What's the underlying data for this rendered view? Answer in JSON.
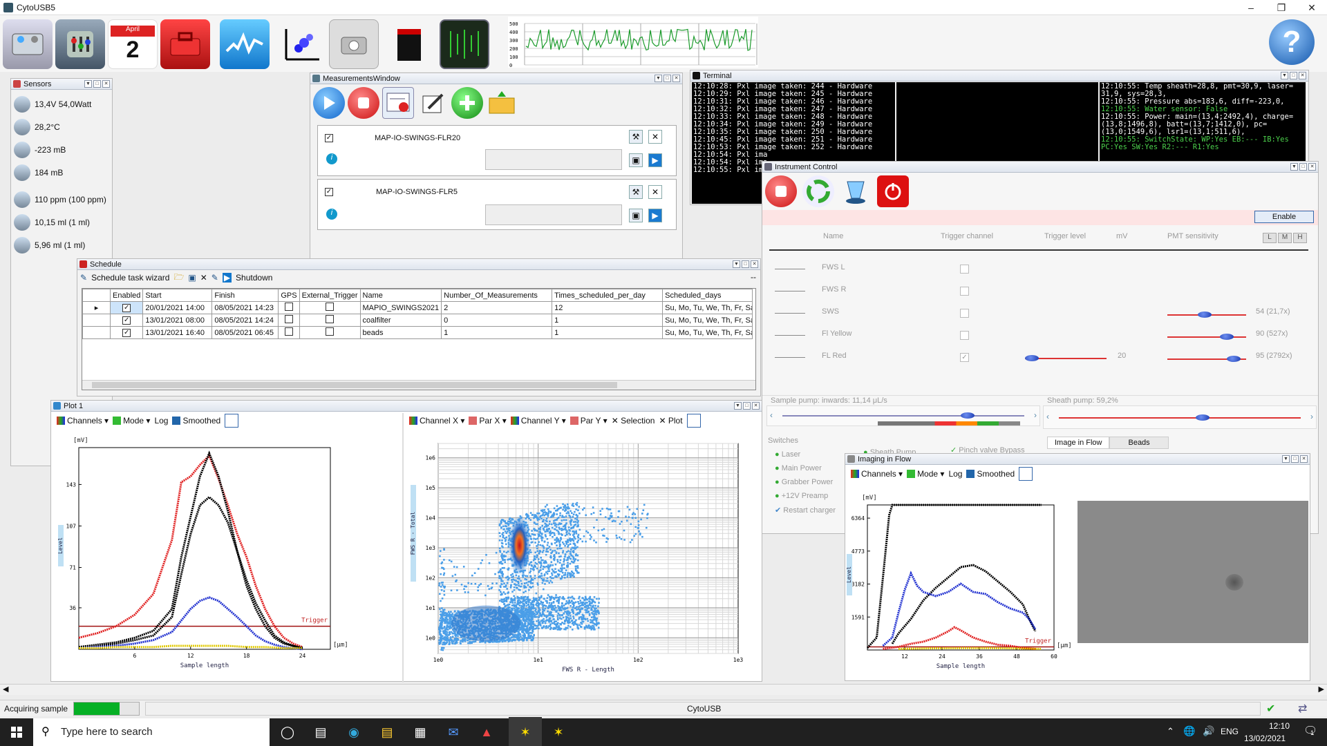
{
  "app": {
    "title": "CytoUSB5"
  },
  "toolbar": {
    "icons": [
      "instrument-icon",
      "sensors-panel-icon",
      "schedule-calendar-icon",
      "toolbox-icon",
      "signal-wave-icon",
      "scatter-plot-icon",
      "camera-icon",
      "cube-icon",
      "terminal-matrix-icon"
    ],
    "calendar_month": "April",
    "calendar_day": "2",
    "mini_chart": {
      "yticks": [
        "500",
        "400",
        "300",
        "200",
        "100",
        "0"
      ]
    },
    "help_symbol": "?"
  },
  "sensors": {
    "title": "Sensors",
    "items": [
      {
        "icon": "battery-icon",
        "value": "13,4V 54,0Watt"
      },
      {
        "icon": "thermometer-icon",
        "value": "28,2°C"
      },
      {
        "icon": "pressure-gauge-icon",
        "value": "-223 mB"
      },
      {
        "icon": "gauge-icon",
        "value": "184 mB"
      },
      {
        "icon": "flask-icon",
        "value": "110 ppm (100 ppm)"
      },
      {
        "icon": "sheath-flask-icon",
        "value": "10,15 ml (1 ml)"
      },
      {
        "icon": "syringe-icon",
        "value": "5,96 ml (1 ml)"
      }
    ]
  },
  "measurements": {
    "title": "MeasurementsWindow",
    "items": [
      {
        "name": "MAP-IO-SWINGS-FLR20"
      },
      {
        "name": "MAP-IO-SWINGS-FLR5"
      }
    ]
  },
  "terminal": {
    "title": "Terminal",
    "left_lines": [
      "12:10:28: Pxl image taken: 244 - Hardware",
      "12:10:29: Pxl image taken: 245 - Hardware",
      "12:10:31: Pxl image taken: 246 - Hardware",
      "12:10:32: Pxl image taken: 247 - Hardware",
      "12:10:33: Pxl image taken: 248 - Hardware",
      "12:10:34: Pxl image taken: 249 - Hardware",
      "12:10:35: Pxl image taken: 250 - Hardware",
      "12:10:45: Pxl image taken: 251 - Hardware",
      "12:10:53: Pxl image taken: 252 - Hardware",
      "12:10:54: Pxl ima",
      "12:10:54: Pxl ima",
      "12:10:55: Pxl ima"
    ],
    "right_lines": [
      {
        "text": "12:10:55: Temp sheath=28,8, pmt=30,9, laser=",
        "color": "#ffffff"
      },
      {
        "text": "31,9, sys=28,3,",
        "color": "#ffffff"
      },
      {
        "text": "12:10:55: Pressure abs=183,6, diff=-223,0,",
        "color": "#ffffff"
      },
      {
        "text": "12:10:55: Water sensor: False",
        "color": "#4cd04c"
      },
      {
        "text": "12:10:55: Power: main=(13,4;2492,4), charge=",
        "color": "#ffffff"
      },
      {
        "text": "(13,8;1496,8), batt=(13,7;1412,0), pc=",
        "color": "#ffffff"
      },
      {
        "text": "(13,0;1549,6), lsr1=(13,1;511,6),",
        "color": "#ffffff"
      },
      {
        "text": "12:10:55: SwitchState: WP:Yes EB:--- IB:Yes",
        "color": "#4cd04c"
      },
      {
        "text": "PC:Yes SW:Yes R2:--- R1:Yes",
        "color": "#4cd04c"
      }
    ]
  },
  "instrument": {
    "title": "Instrument Control",
    "enable_label": "Enable",
    "headers": {
      "name": "Name",
      "trigger_channel": "Trigger channel",
      "trigger_level": "Trigger level",
      "mv": "mV",
      "pmt": "PMT sensitivity"
    },
    "lmh": [
      "L",
      "M",
      "H"
    ],
    "channels": [
      {
        "name": "FWS L",
        "checked": false,
        "mv": "",
        "pmt": ""
      },
      {
        "name": "FWS R",
        "checked": false,
        "mv": "",
        "pmt": ""
      },
      {
        "name": "SWS",
        "checked": false,
        "mv": "",
        "pmt": "54 (21,7x)"
      },
      {
        "name": "Fl Yellow",
        "checked": false,
        "mv": "",
        "pmt": "90 (527x)"
      },
      {
        "name": "FL Red",
        "checked": true,
        "mv": "20",
        "pmt": "95 (2792x)"
      }
    ],
    "sample_pump": "Sample pump: inwards: 11,14 μL/s",
    "sheath_pump": "Sheath pump: 59,2%",
    "switches_title": "Switches",
    "switches": [
      "Laser",
      "Main Power",
      "Grabber Power",
      "+12V Preamp",
      "Restart charger"
    ],
    "switches_right": [
      "Sheath Pump",
      "Pinch valve Bypass"
    ],
    "image_tabs": [
      "Image in Flow",
      "Beads"
    ]
  },
  "schedule": {
    "title": "Schedule",
    "toolbar": {
      "wizard": "Schedule task wizard",
      "shutdown": "Shutdown",
      "more": "--"
    },
    "columns": [
      "Enabled",
      "Start",
      "Finish",
      "GPS",
      "External_Trigger",
      "Name",
      "Number_Of_Measurements",
      "Times_scheduled_per_day",
      "Scheduled_days"
    ],
    "rows": [
      {
        "enabled": true,
        "start": "20/01/2021 14:00",
        "finish": "08/05/2021 14:23",
        "gps": false,
        "ext": false,
        "name": "MAPIO_SWINGS2021",
        "num": "2",
        "times": "12",
        "days": "Su, Mo, Tu, We, Th, Fr, Sa"
      },
      {
        "enabled": true,
        "start": "13/01/2021 08:00",
        "finish": "08/05/2021 14:24",
        "gps": false,
        "ext": false,
        "name": "coalfilter",
        "num": "0",
        "times": "1",
        "days": "Su, Mo, Tu, We, Th, Fr, Sa"
      },
      {
        "enabled": true,
        "start": "13/01/2021 16:40",
        "finish": "08/05/2021 06:45",
        "gps": false,
        "ext": false,
        "name": "beads",
        "num": "1",
        "times": "1",
        "days": "Su, Mo, Tu, We, Th, Fr, Sa"
      }
    ]
  },
  "plot1": {
    "title": "Plot 1",
    "toolbar": {
      "channels": "Channels",
      "mode": "Mode",
      "log": "Log",
      "smoothed": "Smoothed"
    },
    "toolbar2": {
      "channel_x": "Channel X",
      "par_x": "Par X",
      "channel_y": "Channel Y",
      "par_y": "Par Y",
      "selection": "Selection",
      "plot": "Plot"
    }
  },
  "imaging": {
    "title": "Imaging in Flow",
    "toolbar": {
      "channels": "Channels",
      "mode": "Mode",
      "log": "Log",
      "smoothed": "Smoothed"
    }
  },
  "status": {
    "acquiring": "Acquiring sample",
    "progress": 0.7,
    "center": "CytoUSB"
  },
  "taskbar": {
    "search_placeholder": "Type here to search",
    "lang": "ENG",
    "time": "12:10",
    "date": "13/02/2021",
    "notifications": "1"
  },
  "chart_data": [
    {
      "type": "line",
      "xlabel": "Sample length",
      "ylabel": "Level",
      "xunit": "[μm]",
      "yunit": "[mV]",
      "xticks": [
        "6",
        "12",
        "18",
        "24"
      ],
      "yticks": [
        "36",
        "71",
        "107",
        "143"
      ],
      "xlim": [
        0,
        27
      ],
      "ylim": [
        0,
        175
      ],
      "trigger": {
        "label": "Trigger",
        "value": 20
      },
      "series": [
        {
          "color": "#e02020",
          "x": [
            0,
            2,
            4,
            6,
            8,
            10,
            11,
            12,
            13,
            14,
            15,
            16,
            17,
            18,
            19,
            20,
            21,
            22,
            23,
            24
          ],
          "y": [
            10,
            14,
            20,
            30,
            48,
            95,
            145,
            150,
            160,
            168,
            148,
            125,
            100,
            80,
            55,
            35,
            20,
            10,
            5,
            2
          ]
        },
        {
          "color": "#000000",
          "x": [
            0,
            2,
            4,
            6,
            8,
            10,
            11,
            12,
            13,
            14,
            15,
            16,
            17,
            18,
            19,
            20,
            21,
            22,
            23,
            24
          ],
          "y": [
            2,
            4,
            6,
            10,
            16,
            35,
            80,
            115,
            150,
            170,
            150,
            120,
            85,
            55,
            35,
            20,
            10,
            5,
            3,
            1
          ]
        },
        {
          "color": "#000000",
          "x": [
            0,
            2,
            4,
            6,
            8,
            10,
            11,
            12,
            13,
            14,
            15,
            16,
            17,
            18,
            19,
            20,
            21,
            22,
            23,
            24
          ],
          "y": [
            2,
            3,
            5,
            8,
            12,
            28,
            65,
            100,
            125,
            132,
            125,
            110,
            85,
            60,
            40,
            25,
            12,
            6,
            3,
            1
          ]
        },
        {
          "color": "#2030d0",
          "x": [
            0,
            2,
            4,
            6,
            8,
            10,
            11,
            12,
            13,
            14,
            15,
            16,
            17,
            18,
            19,
            20,
            21,
            22,
            23,
            24
          ],
          "y": [
            1,
            2,
            3,
            5,
            8,
            15,
            25,
            35,
            42,
            45,
            42,
            35,
            28,
            20,
            12,
            7,
            4,
            2,
            1,
            0
          ]
        },
        {
          "color": "#e0c800",
          "x": [
            0,
            2,
            4,
            6,
            8,
            10,
            12,
            14,
            16,
            18,
            20,
            22,
            24
          ],
          "y": [
            1,
            1,
            2,
            2,
            2,
            3,
            3,
            3,
            3,
            2,
            2,
            1,
            1
          ]
        }
      ]
    },
    {
      "type": "scatter",
      "xlabel": "FWS R - Length",
      "ylabel": "FWS R - Total",
      "xscale": "log",
      "yscale": "log",
      "xticks": [
        "1e0",
        "1e1",
        "1e2",
        "1e3"
      ],
      "yticks": [
        "1e0",
        "1e1",
        "1e2",
        "1e3",
        "1e4",
        "1e5",
        "1e6"
      ],
      "xlim": [
        1,
        1000
      ],
      "ylim": [
        0.3,
        3000000
      ]
    },
    {
      "type": "line",
      "xlabel": "Sample length",
      "ylabel": "Level",
      "xunit": "[μm]",
      "yunit": "[mV]",
      "xticks": [
        "12",
        "24",
        "36",
        "48",
        "60"
      ],
      "yticks": [
        "1591",
        "3182",
        "4773",
        "6364"
      ],
      "xlim": [
        0,
        60
      ],
      "ylim": [
        0,
        7000
      ],
      "trigger": {
        "label": "Trigger",
        "value": 150
      },
      "series": [
        {
          "color": "#000000",
          "x": [
            0,
            3,
            5,
            7,
            8,
            10,
            12,
            56
          ],
          "y": [
            100,
            600,
            3500,
            6500,
            7000,
            7000,
            7000,
            7000
          ]
        },
        {
          "color": "#000000",
          "x": [
            8,
            10,
            14,
            18,
            22,
            26,
            30,
            34,
            38,
            42,
            46,
            50,
            52,
            54
          ],
          "y": [
            300,
            800,
            1500,
            2400,
            3000,
            3500,
            4000,
            4100,
            3800,
            3300,
            2800,
            2200,
            1500,
            900
          ]
        },
        {
          "color": "#2030d0",
          "x": [
            5,
            8,
            10,
            12,
            14,
            16,
            18,
            22,
            26,
            30,
            34,
            38,
            42,
            46,
            50,
            52,
            54
          ],
          "y": [
            200,
            600,
            1800,
            2900,
            3700,
            3100,
            2800,
            2600,
            2800,
            3200,
            2800,
            2700,
            2300,
            2000,
            1800,
            1500,
            1000
          ]
        },
        {
          "color": "#e02020",
          "x": [
            5,
            10,
            14,
            18,
            22,
            26,
            28,
            30,
            34,
            38,
            42,
            46,
            50,
            54
          ],
          "y": [
            50,
            150,
            300,
            400,
            600,
            900,
            1100,
            950,
            600,
            400,
            250,
            200,
            100,
            50
          ]
        },
        {
          "color": "#e0c800",
          "x": [
            10,
            20,
            30,
            40,
            50,
            56
          ],
          "y": [
            50,
            80,
            90,
            90,
            70,
            50
          ]
        }
      ]
    }
  ]
}
